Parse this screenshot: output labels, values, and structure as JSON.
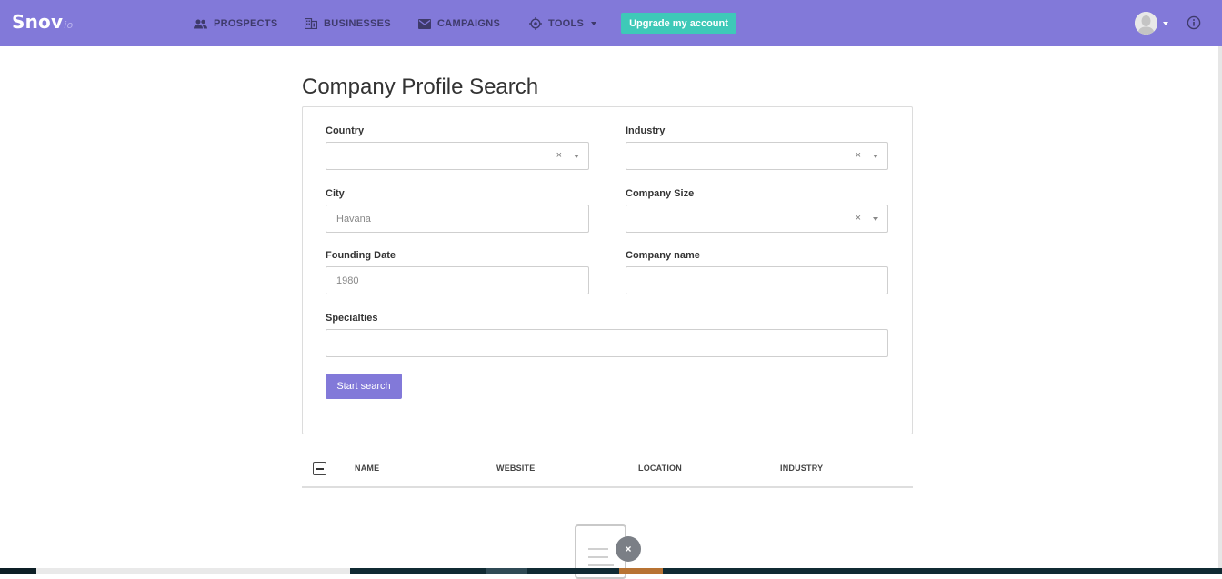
{
  "brand": {
    "name": "Snov",
    "suffix": "io"
  },
  "nav": {
    "prospects": "PROSPECTS",
    "businesses": "BUSINESSES",
    "campaigns": "CAMPAIGNS",
    "tools": "TOOLS",
    "upgrade": "Upgrade my account"
  },
  "page": {
    "title": "Company Profile Search"
  },
  "form": {
    "country_label": "Country",
    "industry_label": "Industry",
    "city_label": "City",
    "city_placeholder": "Havana",
    "company_size_label": "Company Size",
    "founding_date_label": "Founding Date",
    "founding_date_placeholder": "1980",
    "company_name_label": "Company name",
    "specialties_label": "Specialties",
    "clear_glyph": "×",
    "start_search": "Start search"
  },
  "table": {
    "columns": [
      "NAME",
      "WEBSITE",
      "LOCATION",
      "INDUSTRY"
    ]
  },
  "empty_state": {
    "badge_glyph": "×"
  },
  "colors": {
    "topbar": "#8279d9",
    "upgrade": "#3ec9b8",
    "primary_button": "#8279d9"
  }
}
